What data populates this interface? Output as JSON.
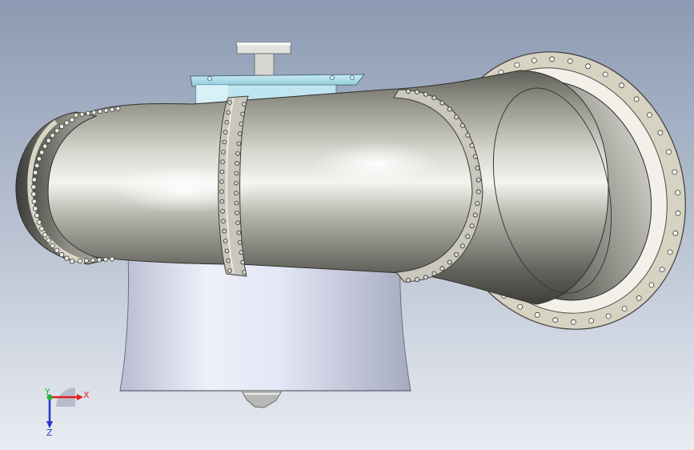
{
  "viewport": {
    "background_top": "#8E9CB5",
    "background_bottom": "#E6EAF1"
  },
  "model": {
    "components": [
      "pump-volute-pipe",
      "pipe-flange-ring",
      "outlet-flange",
      "end-cap",
      "motor-mount-plate",
      "shaft-coupling",
      "suction-cone",
      "cone-nozzle"
    ],
    "colors": {
      "pipe_metal": "#9E9D92",
      "pipe_highlight": "#FFFFFF",
      "flange_face": "#D9D5C7",
      "mount_plate": "#A9D6E4",
      "cone_body": "#DDE2F3",
      "bolt": "#C8C8C8"
    }
  },
  "triad": {
    "x_label": "X",
    "y_label": "Y",
    "z_label": "Z",
    "colors": {
      "x": "#E21F1F",
      "y": "#25B030",
      "z": "#2335C8"
    }
  }
}
